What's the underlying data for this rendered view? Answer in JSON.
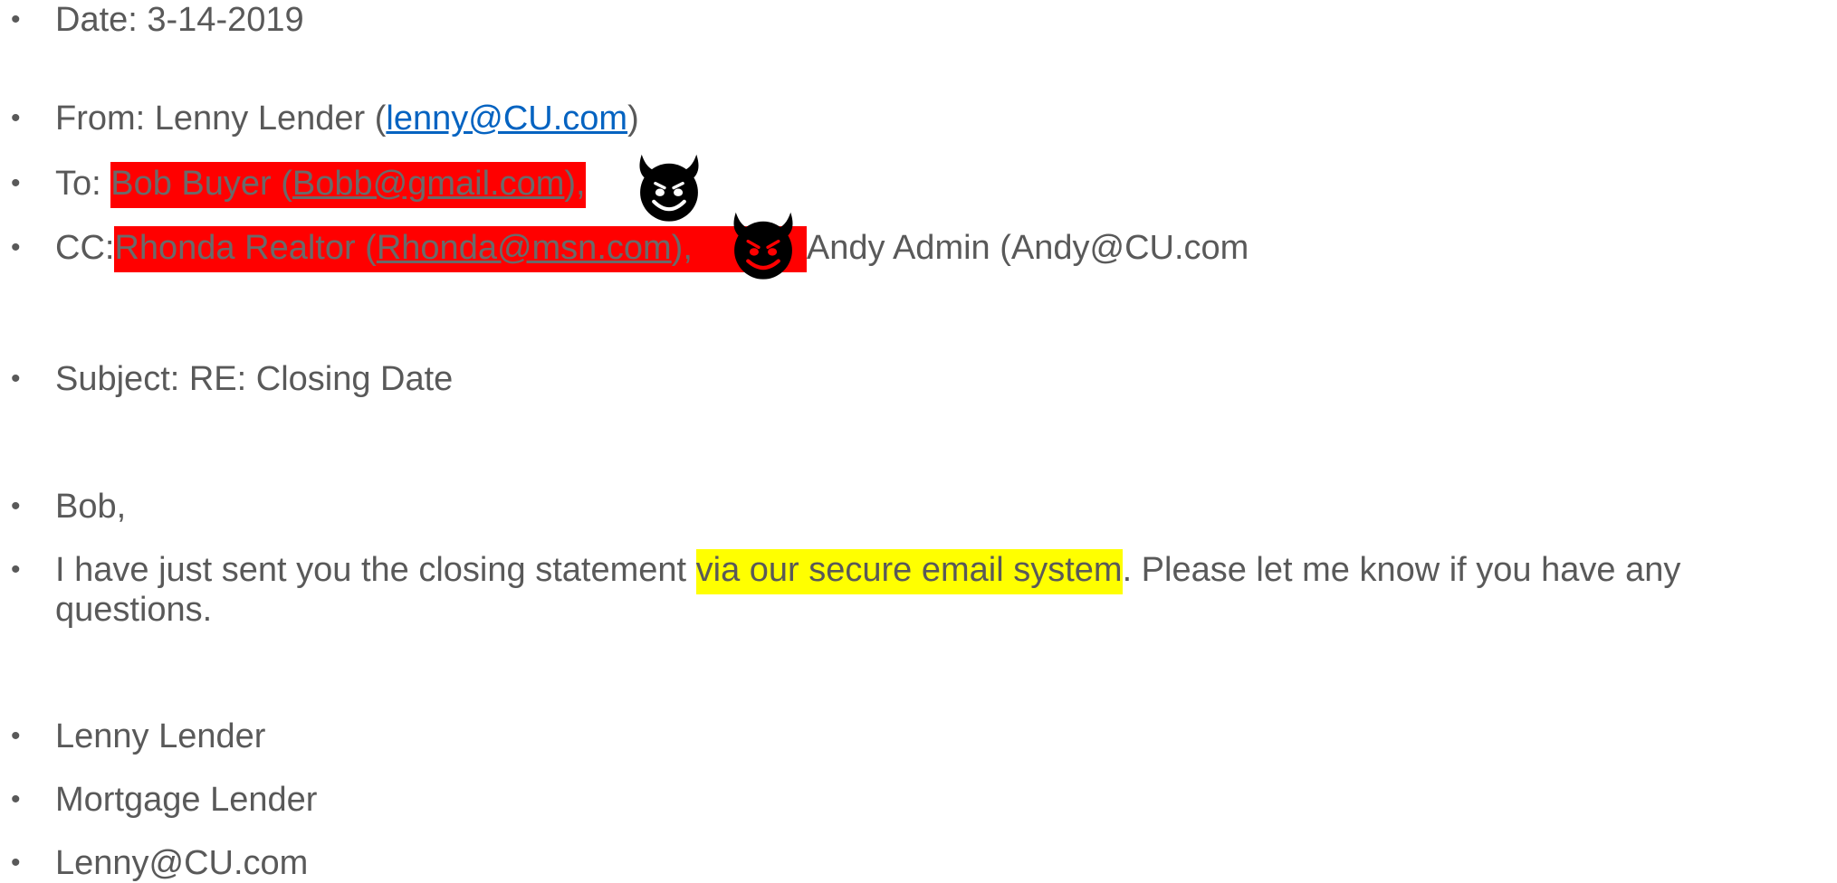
{
  "email": {
    "date": "Date: 3-14-2019",
    "from": {
      "prefix": "From: Lenny Lender (",
      "address": "lenny@CU.com",
      "suffix": ")"
    },
    "to": {
      "prefix": "To:  ",
      "name": "Bob Buyer (",
      "address": "Bobb@gmail.com",
      "suffix": "),"
    },
    "cc": {
      "prefix": "CC:",
      "name": "Rhonda Realtor (",
      "address": "Rhonda@msn.com",
      "suffix": "),",
      "rest": "Andy Admin (Andy@CU.com"
    },
    "subject": "Subject:  RE: Closing Date",
    "greeting": "Bob,",
    "body": {
      "before": "I have just sent you the closing statement ",
      "highlight": "via our secure email system",
      "after": ".  Please let me know if you have any",
      "wrap": "questions."
    },
    "signature": {
      "name": "Lenny Lender",
      "title": "Mortgage Lender",
      "email": "Lenny@CU.com"
    }
  },
  "bullet_glyph": "•",
  "colors": {
    "text": "#595959",
    "link": "#0563c1",
    "redaction": "#ff0000",
    "highlight": "#ffff00",
    "devil_face": "#000000",
    "devil_eyes_to": "#ffffff",
    "devil_eyes_cc": "#ff0000"
  },
  "icons": [
    "smiling-devil-icon",
    "angry-devil-icon"
  ]
}
